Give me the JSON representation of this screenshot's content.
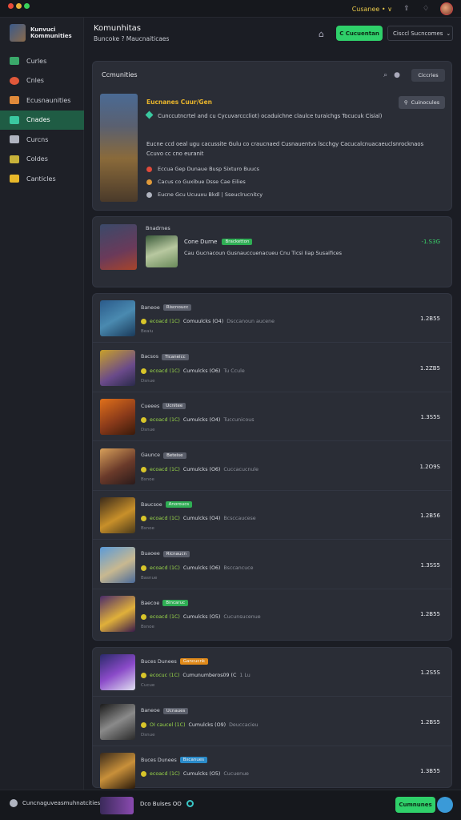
{
  "topbar": {
    "dot_colors": [
      "#e84b3a",
      "#e8b23a",
      "#3ad35a"
    ],
    "user_label": "Cusanee • ∨"
  },
  "sidebar": {
    "brand_line1": "Kunvuci",
    "brand_line2": "Kommunities",
    "items": [
      {
        "label": "Curles",
        "icon": "controller-icon",
        "color": "#3aa86a"
      },
      {
        "label": "Cnles",
        "icon": "fire-icon",
        "color": "#e0583a"
      },
      {
        "label": "Ecusnaunities",
        "icon": "flame-icon",
        "color": "#e08a3a"
      },
      {
        "label": "Cnades",
        "icon": "chart-icon",
        "color": "#3ac8a0",
        "active": true
      },
      {
        "label": "Curcns",
        "icon": "lock-icon",
        "color": "#b0b4c0"
      },
      {
        "label": "Coldes",
        "icon": "trophy-icon",
        "color": "#c8b23a"
      },
      {
        "label": "Canticles",
        "icon": "star-icon",
        "color": "#e8b82a"
      }
    ]
  },
  "header": {
    "title": "Komunhitas",
    "subtitle": "Buncoke ? Maucnaiticaes",
    "green_button": "C Cucuentan",
    "select_value": "Cisccl Sucncomes"
  },
  "hero_card": {
    "title": "Ccmunities",
    "filter_button": "Ciccries",
    "tag": "Eucnanes Cuur/Gen",
    "share_button": "Cuinocules",
    "line1": "Cunccutncrtel and cu Cycuvarcccliot) ocaduichne claulce turaichgs Tocucuk Cisial)",
    "line2": "Eucne ccd oeal ugu cacussite Gulu co craucnaed Cusnauentvs lscchgy Cacucalcnuacaeuclsnrocknaos",
    "line3": "Ccuvo cc cno euranit",
    "bullets": [
      {
        "text": "Eccua Gep Dunaue Busp Sixturo Buucs",
        "color": "#e04a3a"
      },
      {
        "text": "Cacus co Guxibue Dsse Cae Eilies",
        "color": "#e09a3a"
      },
      {
        "text": "Eucne Gcu Ucuuxu Bkdl | Sseuclrucnitcy",
        "color": "#b0b4c0"
      }
    ]
  },
  "featured": {
    "label": "Bnadrnes",
    "name": "Cone Durne",
    "badge": "Bracketton",
    "badge_color": "#2fae54",
    "description": "Cau Gucnacoun Gusnauccuenacueu Cnu Ticsi Iiap Susaifices",
    "price": "-1.S3G"
  },
  "list": [
    {
      "name": "Baneoe",
      "badge": "Riscnoucc",
      "badge_color": "#5a5e6a",
      "rating": "ecoacd (1C)",
      "title": "Comuulcks (O4)",
      "meta": "Dsccanoun aucene",
      "sub": "Beaiu",
      "price": "1.2B55",
      "thumb": "linear-gradient(150deg,#2a5a8a,#4a8ab0 50%,#1a3a5a)"
    },
    {
      "name": "Bacsos",
      "badge": "Ticaneicc",
      "badge_color": "#5a5e6a",
      "rating": "ecoacd (1C)",
      "title": "Cumulcks (O6)",
      "meta": "Tu Ccule",
      "sub": "Dsnue",
      "price": "1.2ZB5",
      "thumb": "linear-gradient(150deg,#c8a02a,#6a4a8a 60%,#2a2a4a)"
    },
    {
      "name": "Cueees",
      "badge": "Ucnitee",
      "badge_color": "#5a5e6a",
      "rating": "ecoacd (1C)",
      "title": "Cumulcks (O4)",
      "meta": "Tuccunicous",
      "sub": "Dsnue",
      "price": "1.3S5S",
      "thumb": "linear-gradient(150deg,#e0701a,#8a3a1a 55%,#3a1a0a)"
    },
    {
      "name": "Gaunce",
      "badge": "Beteise",
      "badge_color": "#5a5e6a",
      "rating": "ecoacd (1C)",
      "title": "Cumulcks (O6)",
      "meta": "Cuccacucnule",
      "sub": "Bsnoe",
      "price": "1.2O9S",
      "thumb": "linear-gradient(150deg,#d8a05a,#6a3a2a 55%,#2a1a1a)"
    },
    {
      "name": "Baucsoe",
      "badge": "Anoroucs",
      "badge_color": "#2fae54",
      "rating": "ecoacd (1C)",
      "title": "Cumulcks (O4)",
      "meta": "Bcsccaucese",
      "sub": "Bsnoe",
      "price": "1.2B56",
      "thumb": "linear-gradient(150deg,#3a2a1a,#c8902a 55%,#4a3a1a)"
    },
    {
      "name": "Buaoee",
      "badge": "Ricnaucn",
      "badge_color": "#5a5e6a",
      "rating": "ecoacd (1C)",
      "title": "Cumulcks (O6)",
      "meta": "Bsccancuce",
      "sub": "Basnue",
      "price": "1.3SS5",
      "thumb": "linear-gradient(150deg,#5a9ad8,#c8b890 55%,#4a6a9a)"
    },
    {
      "name": "Baecoe",
      "badge": "Bincaruc",
      "badge_color": "#2fae54",
      "rating": "ecoacd (1C)",
      "title": "Cumulcks (O5)",
      "meta": "Cucunsucenue",
      "sub": "Bsnoe",
      "price": "1.2B55",
      "thumb": "linear-gradient(150deg,#4a2a6a,#e0b03a 55%,#3a1a4a)"
    }
  ],
  "list2": [
    {
      "name": "Buces Dunees",
      "badge": "Gancucnk",
      "badge_color": "#e08a1a",
      "rating": "ecocuc (1C)",
      "title": "Cumunumberos09 (C",
      "meta": "1 Lu",
      "sub": "Cucue",
      "price": "1.2S5S",
      "thumb": "linear-gradient(150deg,#2a2a6a,#8a4ac8 50%,#e0e0f0)"
    },
    {
      "name": "Baneoe",
      "badge": "Ucnaues",
      "badge_color": "#5a5e6a",
      "rating": "OI caucel (1C)",
      "title": "Cumulcks (O9)",
      "meta": "Deuccacieu",
      "sub": "Dsnue",
      "price": "1.2BS5",
      "thumb": "linear-gradient(150deg,#1a1a1a,#8a8a8a 50%,#2a2a2a)"
    },
    {
      "name": "Buces Dunees",
      "badge": "Bscanues",
      "badge_color": "#2a8ac8",
      "rating": "ecoacd (1C)",
      "title": "Cumulcks (O5)",
      "meta": "Cucuenue",
      "sub": "",
      "price": "1.3B55",
      "thumb": "linear-gradient(150deg,#3a2a1a,#c8903a 50%,#2a1a0a)"
    }
  ],
  "bottombar": {
    "left_label": "Cuncnaguveasmuhnatcities",
    "mid_label": "Dco Buises OO",
    "button": "Cumnunes"
  }
}
